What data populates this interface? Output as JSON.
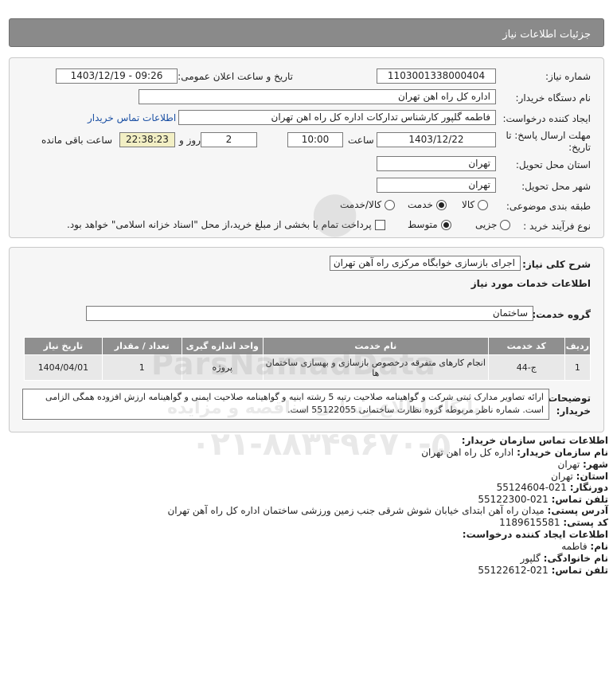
{
  "header": {
    "title": "جزئیات اطلاعات نیاز"
  },
  "form": {
    "need_number": {
      "label": "شماره نیاز:",
      "value": "1103001338000404"
    },
    "announce": {
      "label": "تاریخ و ساعت اعلان عمومی:",
      "value": "1403/12/19 - 09:26"
    },
    "buyer_org": {
      "label": "نام دستگاه خریدار:",
      "value": "اداره کل راه اهن تهران"
    },
    "requester": {
      "label": "ایجاد کننده درخواست:",
      "value": "فاطمه گلپور کارشناس تدارکات اداره کل راه اهن تهران"
    },
    "contact_link": "اطلاعات تماس خریدار",
    "deadline": {
      "label_line1": "مهلت ارسال پاسخ: تا",
      "label_line2": "تاریخ:",
      "date": "1403/12/22",
      "time_label": "ساعت",
      "time": "10:00",
      "days": "2",
      "days_label": "روز و",
      "remaining": "22:38:23",
      "remaining_label": "ساعت باقی مانده"
    },
    "province": {
      "label": "استان محل تحویل:",
      "value": "تهران"
    },
    "city": {
      "label": "شهر محل تحویل:",
      "value": "تهران"
    },
    "category": {
      "label": "طبقه بندی موضوعی:",
      "options": [
        "کالا",
        "خدمت",
        "کالا/خدمت"
      ],
      "selected": "خدمت"
    },
    "process": {
      "label": "نوع فرآیند خرید :",
      "options": [
        "جزیی",
        "متوسط"
      ],
      "selected": "متوسط",
      "checkbox_label": "پرداخت تمام یا بخشی از مبلغ خرید،از محل \"اسناد خزانه اسلامی\" خواهد بود.",
      "checkbox_checked": false
    }
  },
  "summary": {
    "label": "شرح کلی نیاز:",
    "value": "اجرای بازسازی خوابگاه مرکزی راه آهن تهران",
    "services_title": "اطلاعات خدمات مورد نیاز",
    "group_label": "گروه خدمت:",
    "group_value": "ساختمان"
  },
  "table": {
    "headers": [
      "ردیف",
      "کد خدمت",
      "نام خدمت",
      "واحد اندازه گیری",
      "تعداد / مقدار",
      "تاریخ نیاز"
    ],
    "rows": [
      [
        "1",
        "ج-44",
        "انجام کارهای متفرقه درخصوص بازسازی و بهسازی ساختمان ها",
        "پروژه",
        "1",
        "1404/04/01"
      ]
    ]
  },
  "buyer_notes": {
    "label_line1": "توضیحات",
    "label_line2": "خریدار:",
    "text": "ارائه تصاویر مدارک ثبتی شرکت و گواهینامه صلاحیت رتبه 5 رشته ابنیه و گواهینامه صلاحیت ایمنی و گواهینامه ارزش افزوده همگی الزامی است. شماره ناظر مربوطه گروه نظارت ساختمانی 55122055 است."
  },
  "contact": {
    "title": "اطلاعات تماس سازمان خریدار:",
    "org_label": "نام سازمان خریدار:",
    "org": "اداره کل راه اهن تهران",
    "city_label": "شهر:",
    "city": "تهران",
    "province_label": "استان:",
    "province": "تهران",
    "fax_label": "دورنگار:",
    "fax": "021-55124604",
    "phone_label": "تلفن تماس:",
    "phone": "021-55122300",
    "address_label": "آدرس پستی:",
    "address": "میدان راه آهن ابتدای خیابان شوش شرقی جنب زمین ورزشی ساختمان اداره کل راه آهن تهران",
    "postal_label": "کد پستی:",
    "postal": "1189615581",
    "creator_title": "اطلاعات ایجاد کننده درخواست:",
    "name_label": "نام:",
    "name": "فاطمه",
    "family_label": "نام خانوادگی:",
    "family": "گلپور",
    "creator_phone_label": "تلفن تماس:",
    "creator_phone": "021-55122612"
  },
  "watermark": {
    "brand": "ParsNamadData",
    "line": "پایگاه اطلاع رسانی مناقصه و مزایده",
    "phone": "۰۲۱-۸۸۳۴۹۶۷۰-۵"
  }
}
